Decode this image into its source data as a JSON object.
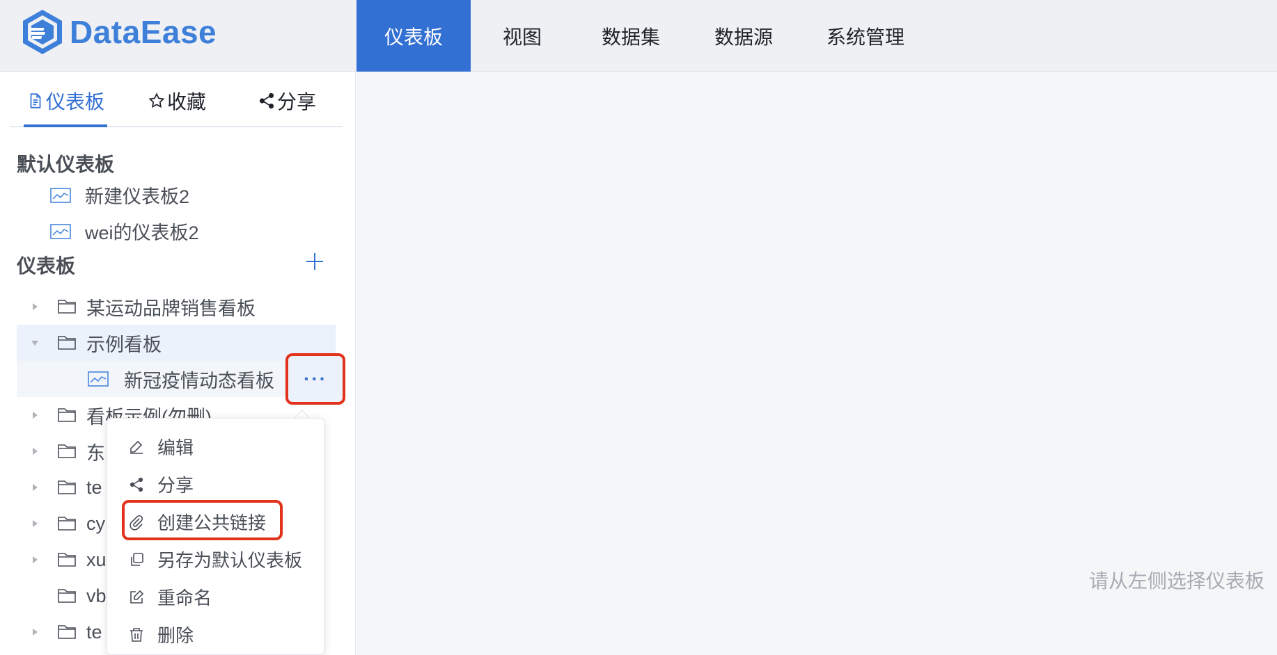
{
  "app": {
    "logo_text": "DataEase"
  },
  "nav": {
    "items": [
      "仪表板",
      "视图",
      "数据集",
      "数据源",
      "系统管理"
    ],
    "active": "仪表板"
  },
  "sidebar": {
    "tabs": {
      "dashboard": "仪表板",
      "favorites": "收藏",
      "share": "分享"
    },
    "default_section": {
      "title": "默认仪表板",
      "items": [
        "新建仪表板2",
        "wei的仪表板2"
      ]
    },
    "dashboard_section": {
      "title": "仪表板",
      "tree": [
        {
          "label": "某运动品牌销售看板"
        },
        {
          "label": "示例看板"
        },
        {
          "label": "新冠疫情动态看板"
        },
        {
          "label": "看板示例(勿删)"
        },
        {
          "label": "东"
        },
        {
          "label": "te"
        },
        {
          "label": "cy"
        },
        {
          "label": "xu"
        },
        {
          "label": "vb"
        },
        {
          "label": "te"
        }
      ]
    },
    "more_label": "···"
  },
  "context_menu": {
    "items": [
      "编辑",
      "分享",
      "创建公共链接",
      "另存为默认仪表板",
      "重命名",
      "删除"
    ]
  },
  "main": {
    "empty_hint": "请从左侧选择仪表板"
  },
  "colors": {
    "accent": "#3370d4",
    "highlight_border": "#e2321c"
  }
}
